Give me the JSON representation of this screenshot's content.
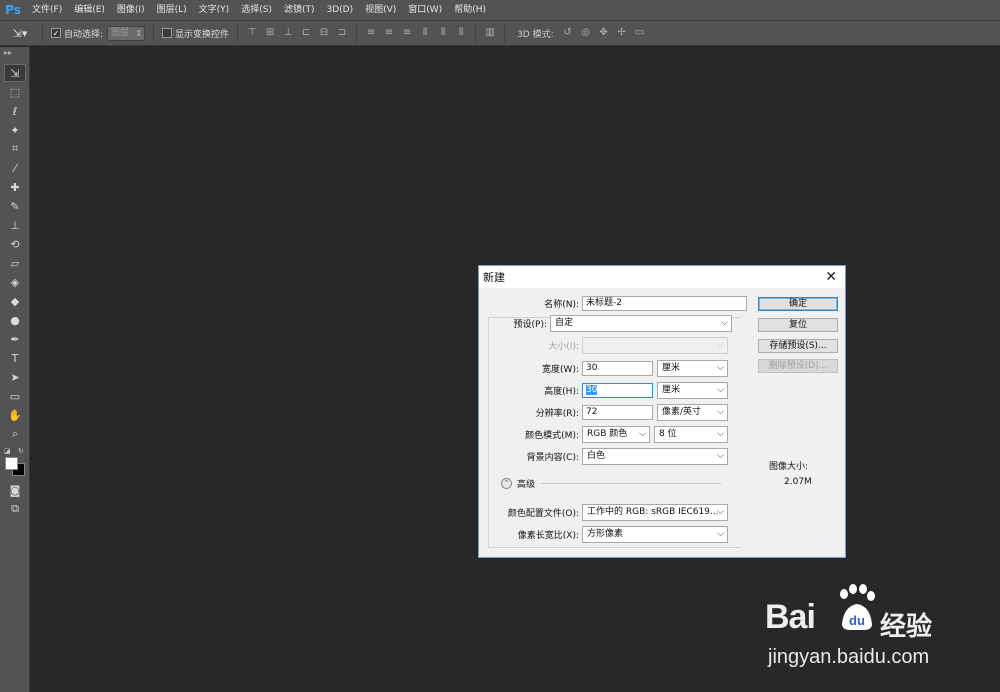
{
  "app": {
    "logo": "Ps"
  },
  "menu": [
    "文件(F)",
    "编辑(E)",
    "图像(I)",
    "图层(L)",
    "文字(Y)",
    "选择(S)",
    "滤镜(T)",
    "3D(D)",
    "视图(V)",
    "窗口(W)",
    "帮助(H)"
  ],
  "options": {
    "auto_select_label": "自动选择:",
    "auto_select_value": "图层",
    "show_transform_label": "显示变换控件",
    "mode_3d_label": "3D 模式:"
  },
  "dialog": {
    "title": "新建",
    "name_label": "名称(N):",
    "name_value": "未标题-2",
    "preset_label": "预设(P):",
    "preset_value": "自定",
    "size_label": "大小(I):",
    "width_label": "宽度(W):",
    "width_value": "30",
    "width_unit": "厘米",
    "height_label": "高度(H):",
    "height_value": "30",
    "height_unit": "厘米",
    "resolution_label": "分辨率(R):",
    "resolution_value": "72",
    "resolution_unit": "像素/英寸",
    "color_mode_label": "颜色模式(M):",
    "color_mode_value": "RGB 颜色",
    "bit_depth_value": "8 位",
    "background_label": "背景内容(C):",
    "background_value": "白色",
    "advanced_label": "高级",
    "color_profile_label": "颜色配置文件(O):",
    "color_profile_value": "工作中的 RGB: sRGB IEC619...",
    "pixel_aspect_label": "像素长宽比(X):",
    "pixel_aspect_value": "方形像素",
    "buttons": {
      "ok": "确定",
      "reset": "复位",
      "save_preset": "存储预设(S)...",
      "delete_preset": "删除预设(D)..."
    },
    "image_size_label": "图像大小:",
    "image_size_value": "2.07M"
  },
  "watermark": {
    "brand_latin": "Bai",
    "brand_cn": "经验",
    "url": "jingyan.baidu.com"
  }
}
